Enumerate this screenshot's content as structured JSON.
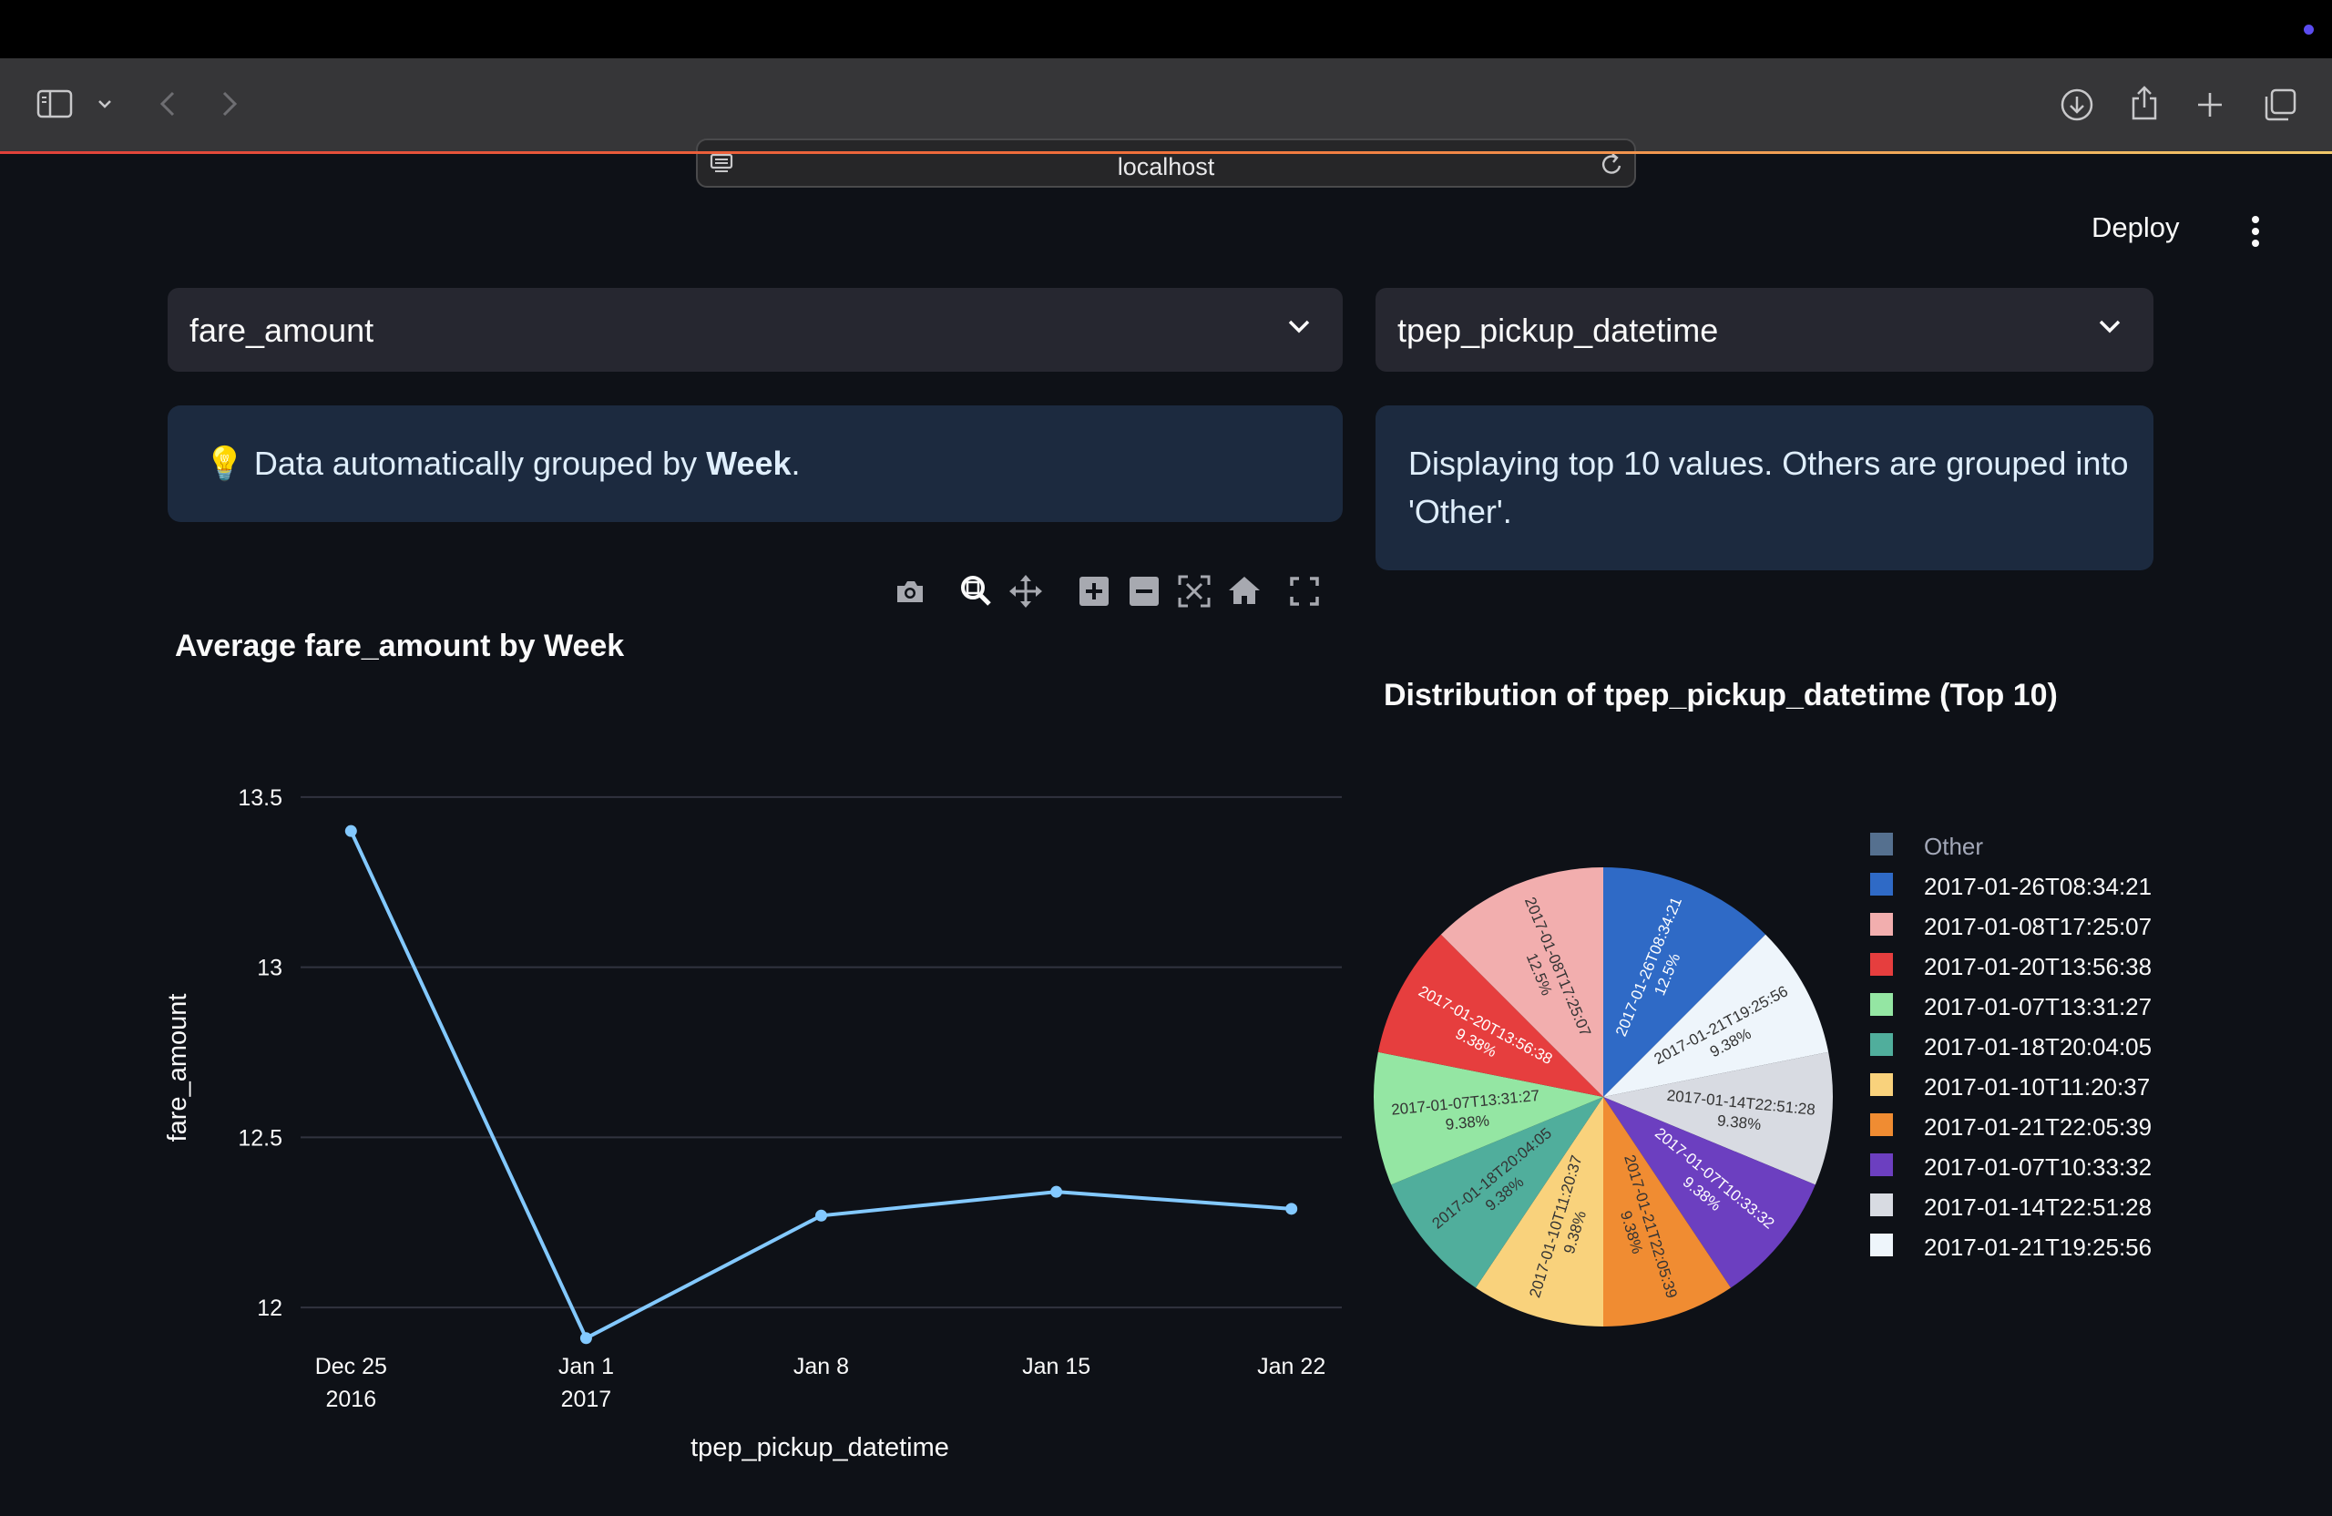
{
  "browser": {
    "url": "localhost"
  },
  "header": {
    "deploy_label": "Deploy"
  },
  "controls": {
    "y_select_value": "fare_amount",
    "x_select_value": "tpep_pickup_datetime"
  },
  "info_left": {
    "icon": "💡",
    "prefix": "Data automatically grouped by ",
    "bold": "Week",
    "suffix": "."
  },
  "info_right": {
    "line1": "Displaying top 10 values. Others are grouped into",
    "line2": "'Other'."
  },
  "modebar_icons": [
    "camera-icon",
    "zoom-icon",
    "pan-icon",
    "zoom-in-icon",
    "zoom-out-icon",
    "autoscale-icon",
    "reset-axes-icon",
    "fullscreen-icon"
  ],
  "chart_data": [
    {
      "type": "line",
      "title": "Average fare_amount by Week",
      "xlabel": "tpep_pickup_datetime",
      "ylabel": "fare_amount",
      "x": [
        "2016-12-25",
        "2017-01-01",
        "2017-01-08",
        "2017-01-15",
        "2017-01-22"
      ],
      "y": [
        13.4,
        11.91,
        12.27,
        12.34,
        12.29
      ],
      "x_ticks": [
        {
          "line1": "Dec 25",
          "line2": "2016"
        },
        {
          "line1": "Jan 1",
          "line2": "2017"
        },
        {
          "line1": "Jan 8",
          "line2": ""
        },
        {
          "line1": "Jan 15",
          "line2": ""
        },
        {
          "line1": "Jan 22",
          "line2": ""
        }
      ],
      "y_ticks": [
        "12",
        "12.5",
        "13",
        "13.5"
      ],
      "ylim": [
        11.88,
        13.62
      ],
      "line_color": "#83c9ff",
      "grid": true
    },
    {
      "type": "pie",
      "title": "Distribution of tpep_pickup_datetime (Top 10)",
      "legend_position": "right",
      "slices": [
        {
          "label": "2017-01-26T08:34:21",
          "percent": 12.5,
          "text": "12.5%",
          "color": "#2f6ac6",
          "text_color": "#ffffff"
        },
        {
          "label": "2017-01-21T19:25:56",
          "percent": 9.38,
          "text": "9.38%",
          "color": "#eef5fb",
          "text_color": "#333333"
        },
        {
          "label": "2017-01-14T22:51:28",
          "percent": 9.38,
          "text": "9.38%",
          "color": "#d8dbe2",
          "text_color": "#333333"
        },
        {
          "label": "2017-01-07T10:33:32",
          "percent": 9.38,
          "text": "9.38%",
          "color": "#6c3fc0",
          "text_color": "#ffffff"
        },
        {
          "label": "2017-01-21T22:05:39",
          "percent": 9.38,
          "text": "9.38%",
          "color": "#f08c32",
          "text_color": "#333333"
        },
        {
          "label": "2017-01-10T11:20:37",
          "percent": 9.38,
          "text": "9.38%",
          "color": "#f9d27c",
          "text_color": "#333333"
        },
        {
          "label": "2017-01-18T20:04:05",
          "percent": 9.38,
          "text": "9.38%",
          "color": "#50ae9c",
          "text_color": "#333333"
        },
        {
          "label": "2017-01-07T13:31:27",
          "percent": 9.38,
          "text": "9.38%",
          "color": "#94e6a3",
          "text_color": "#333333"
        },
        {
          "label": "2017-01-20T13:56:38",
          "percent": 9.38,
          "text": "9.38%",
          "color": "#e63e3e",
          "text_color": "#ffffff"
        },
        {
          "label": "2017-01-08T17:25:07",
          "percent": 12.5,
          "text": "12.5%",
          "color": "#f2aeae",
          "text_color": "#333333"
        }
      ],
      "legend": [
        {
          "label": "Other",
          "color": "#55708f"
        },
        {
          "label": "2017-01-26T08:34:21",
          "color": "#2f6ac6"
        },
        {
          "label": "2017-01-08T17:25:07",
          "color": "#f2aeae"
        },
        {
          "label": "2017-01-20T13:56:38",
          "color": "#e63e3e"
        },
        {
          "label": "2017-01-07T13:31:27",
          "color": "#94e6a3"
        },
        {
          "label": "2017-01-18T20:04:05",
          "color": "#50ae9c"
        },
        {
          "label": "2017-01-10T11:20:37",
          "color": "#f9d27c"
        },
        {
          "label": "2017-01-21T22:05:39",
          "color": "#f08c32"
        },
        {
          "label": "2017-01-07T10:33:32",
          "color": "#6c3fc0"
        },
        {
          "label": "2017-01-14T22:51:28",
          "color": "#d8dbe2"
        },
        {
          "label": "2017-01-21T19:25:56",
          "color": "#eef5fb"
        }
      ]
    }
  ]
}
